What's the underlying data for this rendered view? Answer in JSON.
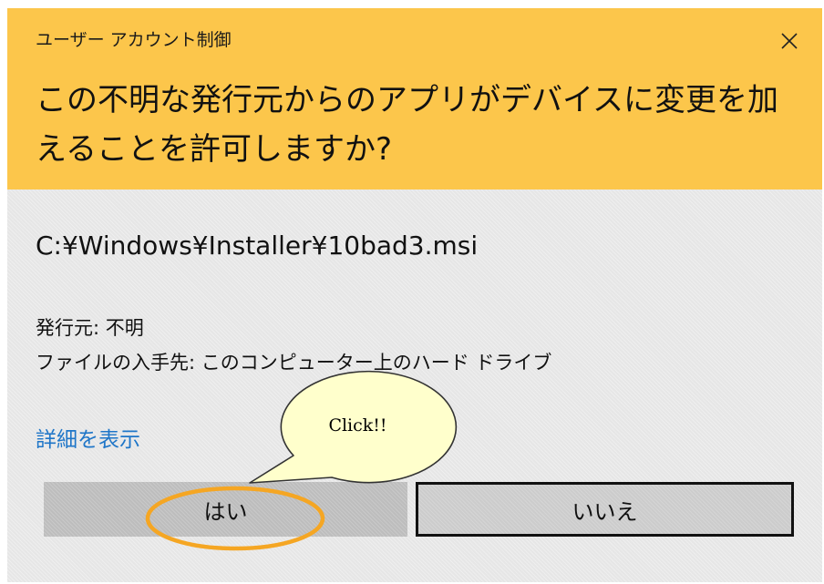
{
  "window": {
    "title": "ユーザー アカウント制御",
    "close_icon": "close-icon"
  },
  "header": {
    "question": "この不明な発行元からのアプリがデバイスに変更を加えることを許可しますか?",
    "background_color": "#fcc64b"
  },
  "body": {
    "program_path": "C:¥Windows¥Installer¥10bad3.msi",
    "publisher": "発行元: 不明",
    "file_origin": "ファイルの入手先: このコンピューター上のハード ドライブ",
    "details_link": "詳細を表示",
    "link_color": "#1f76c8"
  },
  "buttons": {
    "yes_label": "はい",
    "no_label": "いいえ"
  },
  "annotation": {
    "callout_text": "Click!!",
    "callout_fill": "#ffffcc",
    "highlight_color": "#f5a623"
  }
}
